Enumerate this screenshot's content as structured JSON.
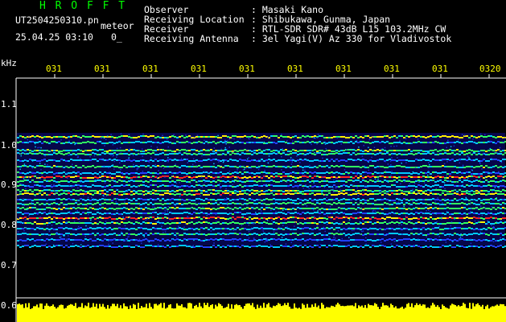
{
  "header": {
    "app_name": "H R O F F T",
    "filename": "UT2504250310.pn",
    "tag": "meteor",
    "datetime": "25.04.25 03:10",
    "extra": "0_",
    "fields": [
      {
        "label": "Observer",
        "value": ": Masaki Kano"
      },
      {
        "label": "Receiving Location",
        "value": ": Shibukawa, Gunma, Japan"
      },
      {
        "label": "Receiver",
        "value": ": RTL-SDR SDR# 43dB L15 103.2MHz CW"
      },
      {
        "label": "Receiving Antenna",
        "value": ": 3el Yagi(V) Az 330 for Vladivostok"
      }
    ]
  },
  "axes": {
    "y_unit": "kHz",
    "y_labels": [
      "1.1",
      "1.0",
      "0.9",
      "0.8",
      "0.7",
      "0.6"
    ],
    "x_labels": [
      "031",
      "031",
      "031",
      "031",
      "031",
      "031",
      "031",
      "031",
      "031",
      "0320"
    ]
  },
  "colors": {
    "background": "#000000",
    "header_name": "#00ff00",
    "header_text": "#ffffff",
    "time_labels": "#ffff00",
    "signal_low": "#1010a0",
    "signal_mid": "#00c8ff",
    "signal_high": "#ff2020",
    "level_bar": "#ffff00"
  }
}
